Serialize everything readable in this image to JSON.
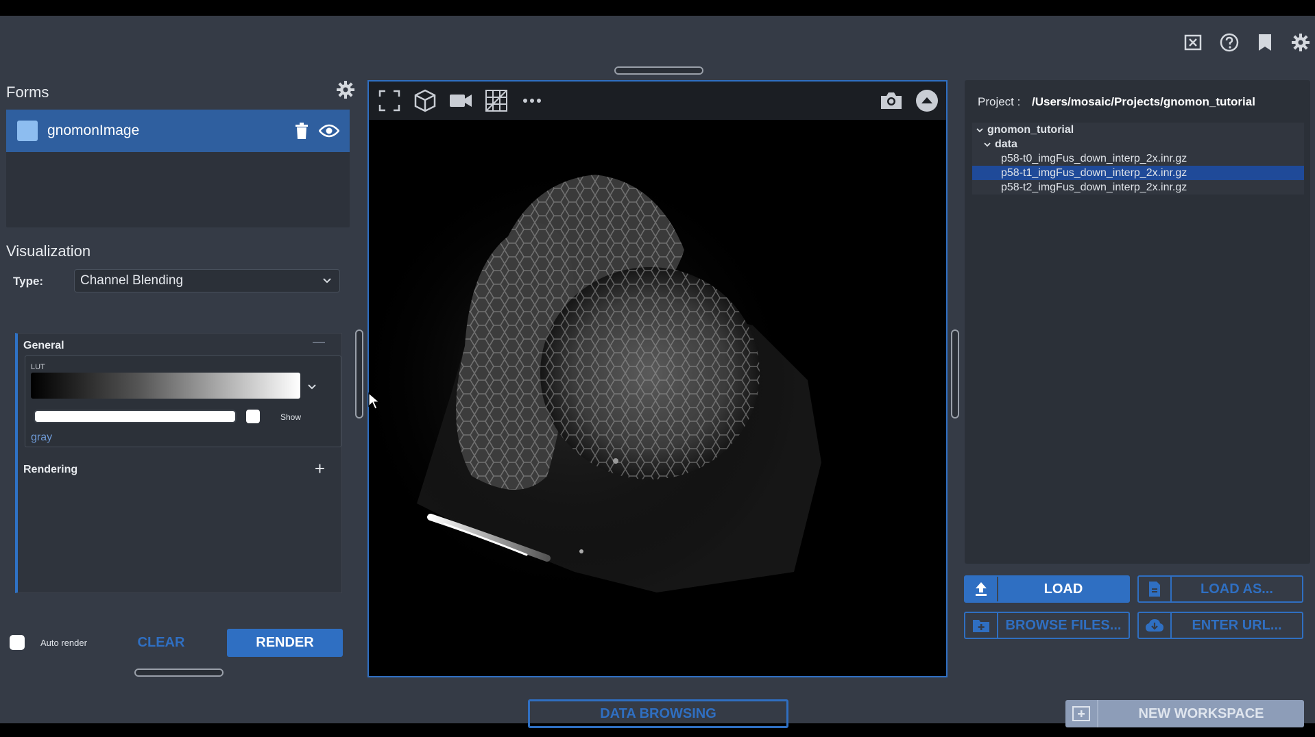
{
  "header": {
    "icons": [
      "close-window-icon",
      "help-icon",
      "bookmark-icon",
      "settings-icon"
    ]
  },
  "forms": {
    "title": "Forms",
    "items": [
      {
        "name": "gnomonImage",
        "color": "#8dbdf0"
      }
    ]
  },
  "visualization": {
    "title": "Visualization",
    "type_label": "Type:",
    "type_value": "Channel Blending",
    "general": {
      "title": "General",
      "lut_label": "LUT",
      "lut_name": "gray",
      "show_label": "Show"
    },
    "rendering_title": "Rendering"
  },
  "render_controls": {
    "auto_render_label": "Auto render",
    "clear_label": "CLEAR",
    "render_label": "RENDER"
  },
  "viewer": {
    "toolbar_left": [
      "fullscreen-icon",
      "cube-icon",
      "camera-video-icon",
      "grid-icon",
      "more-icon"
    ],
    "toolbar_right": [
      "screenshot-icon",
      "collapse-icon"
    ]
  },
  "project": {
    "label": "Project :",
    "path": "/Users/mosaic/Projects/gnomon_tutorial",
    "tree": [
      {
        "label": "gnomon_tutorial",
        "level": 0,
        "expanded": true
      },
      {
        "label": "data",
        "level": 1,
        "expanded": true
      },
      {
        "label": "p58-t0_imgFus_down_interp_2x.inr.gz",
        "level": 2
      },
      {
        "label": "p58-t1_imgFus_down_interp_2x.inr.gz",
        "level": 2,
        "selected": true
      },
      {
        "label": "p58-t2_imgFus_down_interp_2x.inr.gz",
        "level": 2
      }
    ]
  },
  "actions": {
    "load": "LOAD",
    "load_as": "LOAD AS...",
    "browse": "BROWSE FILES...",
    "enter_url": "ENTER URL..."
  },
  "bottom": {
    "data_browsing": "DATA BROWSING",
    "new_workspace": "NEW WORKSPACE"
  },
  "colors": {
    "accent": "#2f6fc2",
    "background": "#353b46",
    "panel": "#2b3038"
  }
}
